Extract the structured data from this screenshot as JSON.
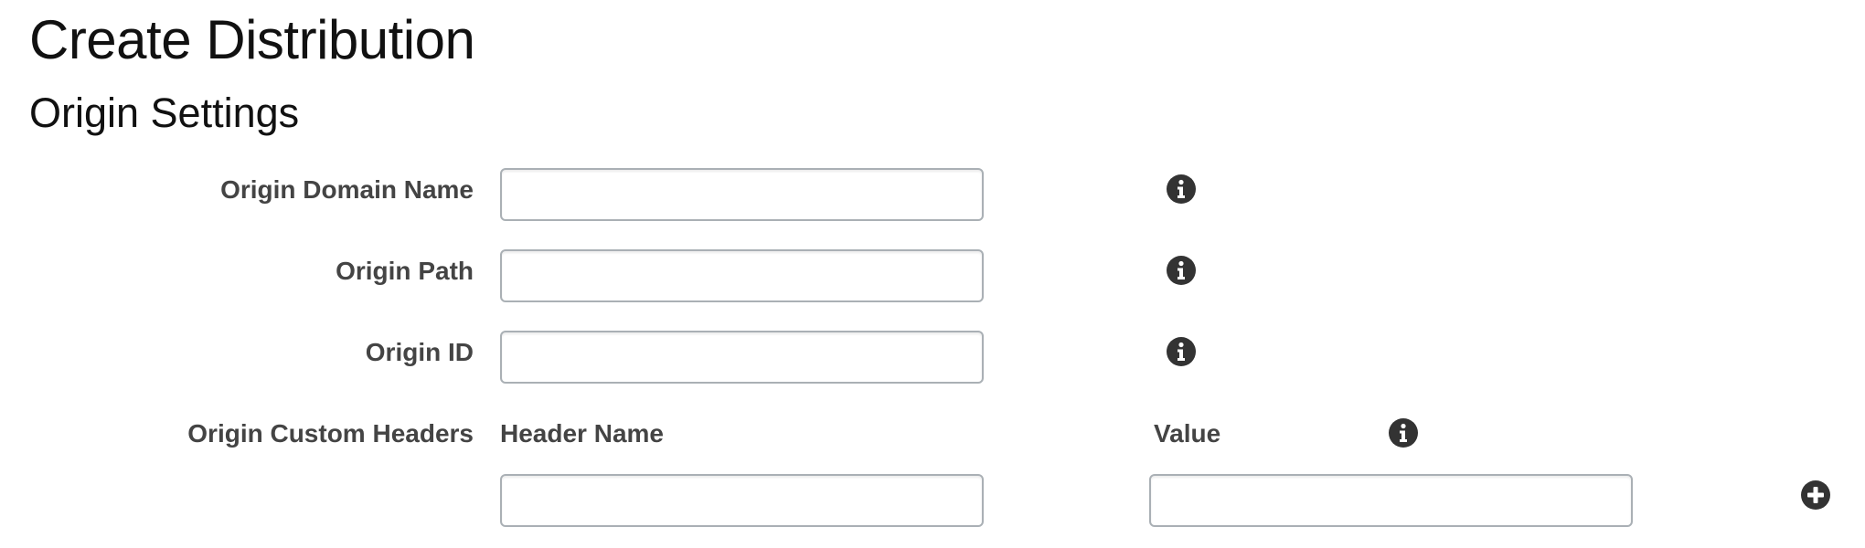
{
  "page": {
    "title": "Create Distribution"
  },
  "origin_settings": {
    "title": "Origin Settings",
    "fields": [
      {
        "label": "Origin Domain Name",
        "value": "",
        "placeholder": ""
      },
      {
        "label": "Origin Path",
        "value": "",
        "placeholder": ""
      },
      {
        "label": "Origin ID",
        "value": "",
        "placeholder": ""
      }
    ],
    "custom_headers": {
      "label": "Origin Custom Headers",
      "header_name_label": "Header Name",
      "value_label": "Value",
      "header_name_value": "",
      "value_value": ""
    }
  },
  "icons": {
    "info": "info-circle-icon",
    "add": "plus-circle-icon"
  },
  "colors": {
    "label_text": "#444444",
    "icon_fill": "#333333",
    "input_border": "#aab0b5"
  }
}
